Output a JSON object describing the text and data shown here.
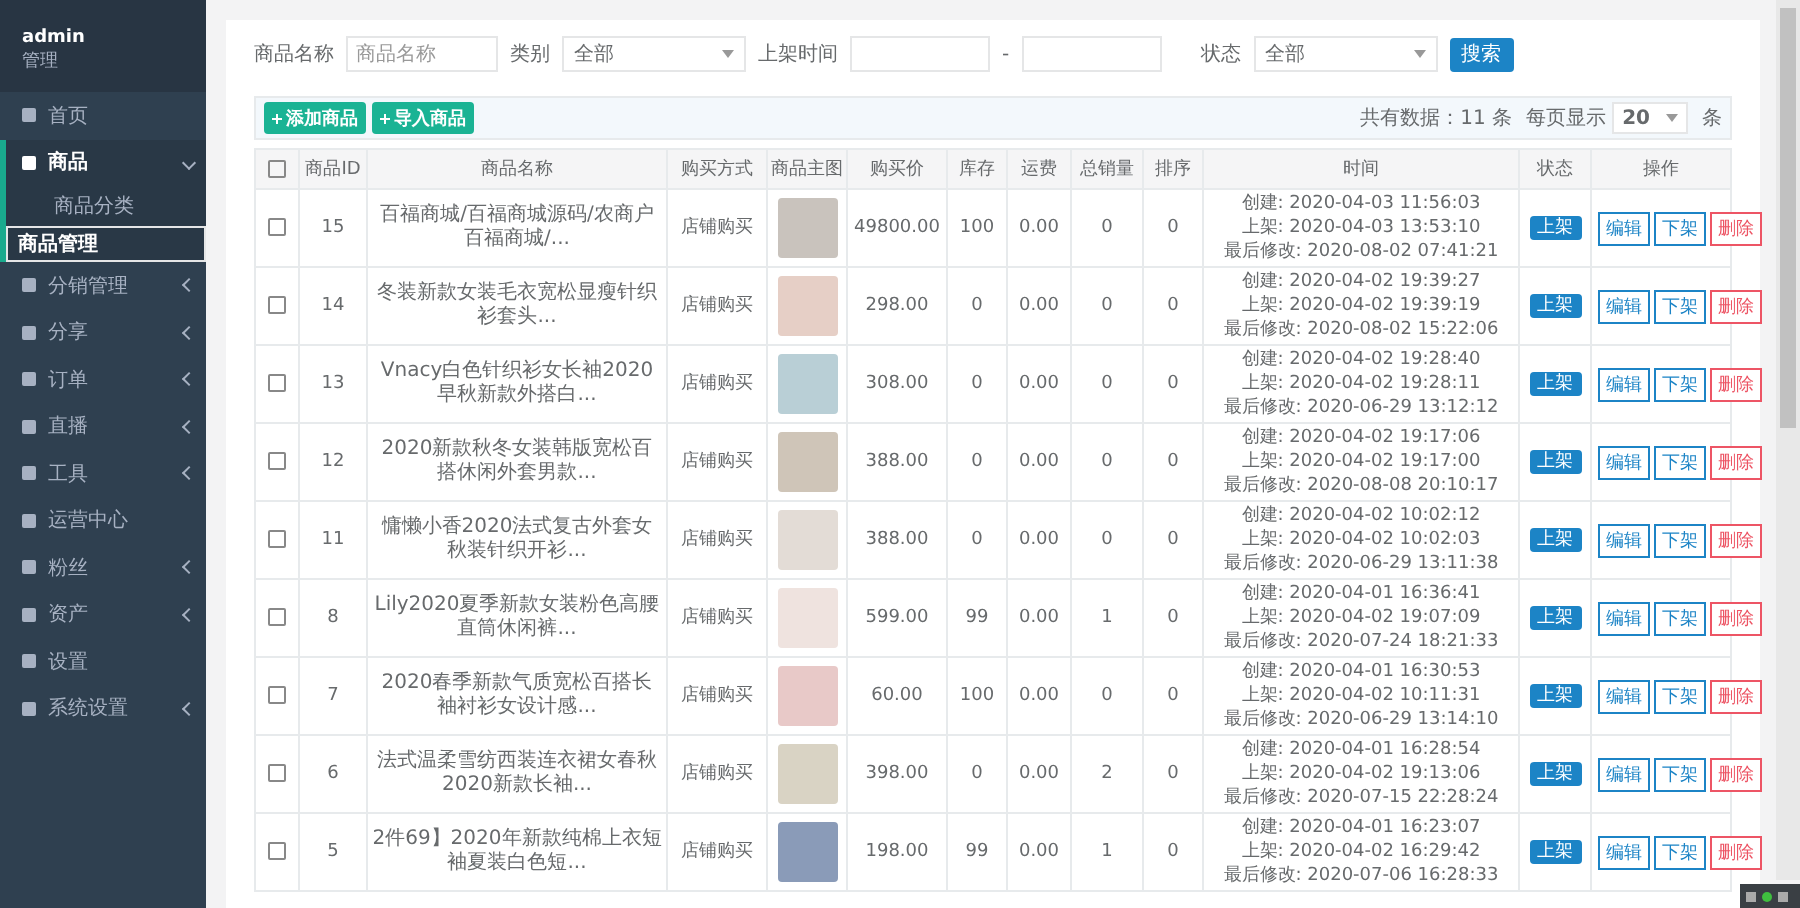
{
  "sidebar": {
    "user": {
      "name": "admin",
      "role": "管理"
    },
    "items": [
      {
        "label": "首页",
        "expandable": false,
        "expanded": false
      },
      {
        "label": "商品",
        "expandable": true,
        "expanded": true,
        "children": [
          {
            "label": "商品分类",
            "selected": false
          },
          {
            "label": "商品管理",
            "selected": true
          }
        ]
      },
      {
        "label": "分销管理",
        "expandable": true,
        "expanded": false
      },
      {
        "label": "分享",
        "expandable": true,
        "expanded": false
      },
      {
        "label": "订单",
        "expandable": true,
        "expanded": false
      },
      {
        "label": "直播",
        "expandable": true,
        "expanded": false
      },
      {
        "label": "工具",
        "expandable": true,
        "expanded": false
      },
      {
        "label": "运营中心",
        "expandable": false,
        "expanded": false
      },
      {
        "label": "粉丝",
        "expandable": true,
        "expanded": false
      },
      {
        "label": "资产",
        "expandable": true,
        "expanded": false
      },
      {
        "label": "设置",
        "expandable": false,
        "expanded": false
      },
      {
        "label": "系统设置",
        "expandable": true,
        "expanded": false
      }
    ]
  },
  "filters": {
    "name_label": "商品名称",
    "name_placeholder": "商品名称",
    "category_label": "类别",
    "category_value": "全部",
    "time_label": "上架时间",
    "time_separator": "-",
    "status_label": "状态",
    "status_value": "全部",
    "search_button": "搜索"
  },
  "toolbar": {
    "buttons": [
      "添加商品",
      "导入商品"
    ],
    "total": "共有数据：11 条",
    "per_page_label": "每页显示",
    "per_page_value": "20",
    "per_page_unit": "条"
  },
  "table": {
    "select_all_checked": false,
    "columns": [
      "商品ID",
      "商品名称",
      "购买方式",
      "商品主图",
      "购买价",
      "库存",
      "运费",
      "总销量",
      "排序",
      "时间",
      "状态",
      "操作"
    ],
    "rows": [
      {
        "checked": false,
        "id": "15",
        "name": "百福商城/百福商城源码/农商户百福商城/...",
        "method": "店铺购买",
        "price": "49800.00",
        "stock": "100",
        "freight": "0.00",
        "sales": "0",
        "sort": "0",
        "created": "创建: 2020-04-03 11:56:03",
        "listed": "上架: 2020-04-03 13:53:10",
        "modified": "最后修改: 2020-08-02 07:41:21",
        "status": "上架",
        "actions": [
          "编辑",
          "下架",
          "删除"
        ]
      },
      {
        "checked": false,
        "id": "14",
        "name": "冬装新款女装毛衣宽松显瘦针织衫套头...",
        "method": "店铺购买",
        "price": "298.00",
        "stock": "0",
        "freight": "0.00",
        "sales": "0",
        "sort": "0",
        "created": "创建: 2020-04-02 19:39:27",
        "listed": "上架: 2020-04-02 19:39:19",
        "modified": "最后修改: 2020-08-02 15:22:06",
        "status": "上架",
        "actions": [
          "编辑",
          "下架",
          "删除"
        ]
      },
      {
        "checked": false,
        "id": "13",
        "name": "Vnacy白色针织衫女长袖2020早秋新款外搭白...",
        "method": "店铺购买",
        "price": "308.00",
        "stock": "0",
        "freight": "0.00",
        "sales": "0",
        "sort": "0",
        "created": "创建: 2020-04-02 19:28:40",
        "listed": "上架: 2020-04-02 19:28:11",
        "modified": "最后修改: 2020-06-29 13:12:12",
        "status": "上架",
        "actions": [
          "编辑",
          "下架",
          "删除"
        ]
      },
      {
        "checked": false,
        "id": "12",
        "name": "2020新款秋冬女装韩版宽松百搭休闲外套男款...",
        "method": "店铺购买",
        "price": "388.00",
        "stock": "0",
        "freight": "0.00",
        "sales": "0",
        "sort": "0",
        "created": "创建: 2020-04-02 19:17:06",
        "listed": "上架: 2020-04-02 19:17:00",
        "modified": "最后修改: 2020-08-08 20:10:17",
        "status": "上架",
        "actions": [
          "编辑",
          "下架",
          "删除"
        ]
      },
      {
        "checked": false,
        "id": "11",
        "name": "慵懒小香2020法式复古外套女秋装针织开衫...",
        "method": "店铺购买",
        "price": "388.00",
        "stock": "0",
        "freight": "0.00",
        "sales": "0",
        "sort": "0",
        "created": "创建: 2020-04-02 10:02:12",
        "listed": "上架: 2020-04-02 10:02:03",
        "modified": "最后修改: 2020-06-29 13:11:38",
        "status": "上架",
        "actions": [
          "编辑",
          "下架",
          "删除"
        ]
      },
      {
        "checked": false,
        "id": "8",
        "name": "Lily2020夏季新款女装粉色高腰直筒休闲裤...",
        "method": "店铺购买",
        "price": "599.00",
        "stock": "99",
        "freight": "0.00",
        "sales": "1",
        "sort": "0",
        "created": "创建: 2020-04-01 16:36:41",
        "listed": "上架: 2020-04-02 19:07:09",
        "modified": "最后修改: 2020-07-24 18:21:33",
        "status": "上架",
        "actions": [
          "编辑",
          "下架",
          "删除"
        ]
      },
      {
        "checked": false,
        "id": "7",
        "name": "2020春季新款气质宽松百搭长袖衬衫女设计感...",
        "method": "店铺购买",
        "price": "60.00",
        "stock": "100",
        "freight": "0.00",
        "sales": "0",
        "sort": "0",
        "created": "创建: 2020-04-01 16:30:53",
        "listed": "上架: 2020-04-02 10:11:31",
        "modified": "最后修改: 2020-06-29 13:14:10",
        "status": "上架",
        "actions": [
          "编辑",
          "下架",
          "删除"
        ]
      },
      {
        "checked": false,
        "id": "6",
        "name": "法式温柔雪纺西装连衣裙女春秋2020新款长袖...",
        "method": "店铺购买",
        "price": "398.00",
        "stock": "0",
        "freight": "0.00",
        "sales": "2",
        "sort": "0",
        "created": "创建: 2020-04-01 16:28:54",
        "listed": "上架: 2020-04-02 19:13:06",
        "modified": "最后修改: 2020-07-15 22:28:24",
        "status": "上架",
        "actions": [
          "编辑",
          "下架",
          "删除"
        ]
      },
      {
        "checked": false,
        "id": "5",
        "name": "2件69】2020年新款纯棉上衣短袖夏装白色短...",
        "method": "店铺购买",
        "price": "198.00",
        "stock": "99",
        "freight": "0.00",
        "sales": "1",
        "sort": "0",
        "created": "创建: 2020-04-01 16:23:07",
        "listed": "上架: 2020-04-02 16:29:42",
        "modified": "最后修改: 2020-07-06 16:28:33",
        "status": "上架",
        "actions": [
          "编辑",
          "下架",
          "删除"
        ]
      }
    ]
  }
}
